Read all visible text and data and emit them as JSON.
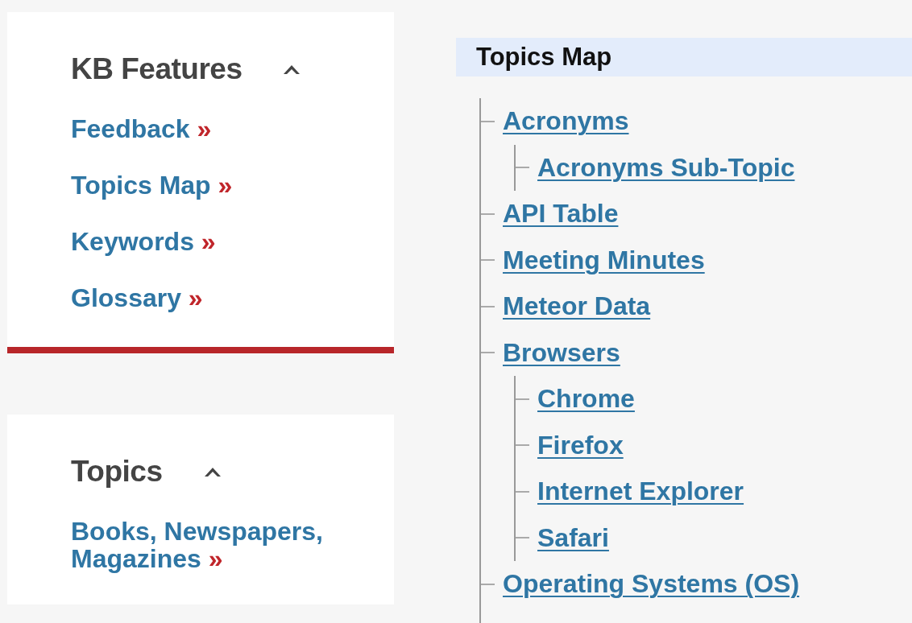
{
  "sidebar": {
    "sections": [
      {
        "title": "KB Features",
        "expanded": true,
        "links": [
          {
            "label": "Feedback",
            "arrow": "»"
          },
          {
            "label": "Topics Map",
            "arrow": "»"
          },
          {
            "label": "Keywords",
            "arrow": "»"
          },
          {
            "label": "Glossary",
            "arrow": "»"
          }
        ]
      },
      {
        "title": "Topics",
        "expanded": true,
        "links": [
          {
            "label": "Books, Newspapers, Magazines",
            "arrow": "»"
          }
        ]
      }
    ]
  },
  "topics_map": {
    "title": "Topics Map",
    "tree": [
      {
        "label": "Acronyms",
        "children": [
          {
            "label": "Acronyms Sub-Topic"
          }
        ]
      },
      {
        "label": "API Table"
      },
      {
        "label": "Meeting Minutes"
      },
      {
        "label": "Meteor Data"
      },
      {
        "label": "Browsers",
        "children": [
          {
            "label": "Chrome"
          },
          {
            "label": "Firefox"
          },
          {
            "label": "Internet Explorer"
          },
          {
            "label": "Safari"
          }
        ]
      },
      {
        "label": "Operating Systems (OS)"
      }
    ]
  }
}
